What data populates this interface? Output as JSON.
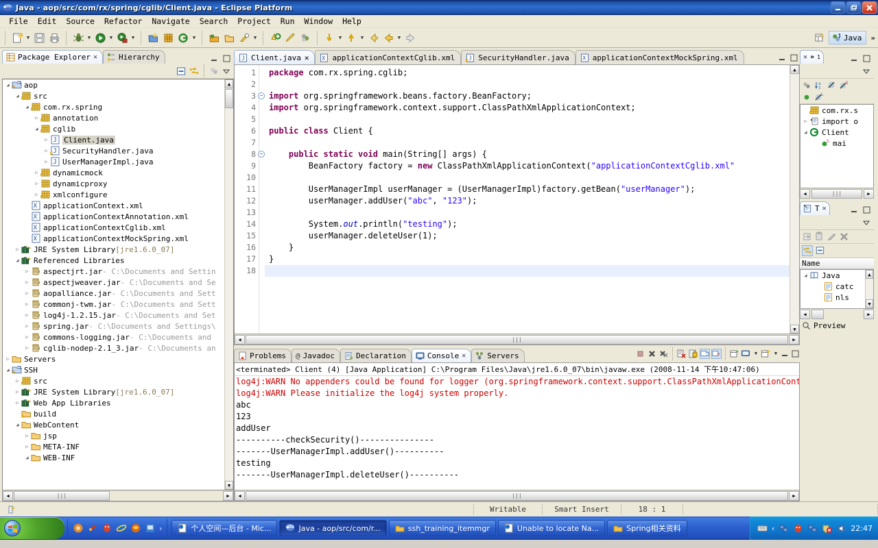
{
  "window": {
    "title": "Java - aop/src/com/rx/spring/cglib/Client.java - Eclipse Platform",
    "minimize": "—",
    "restore": "❐",
    "close": "✕"
  },
  "menubar": {
    "items": [
      "File",
      "Edit",
      "Source",
      "Refactor",
      "Navigate",
      "Search",
      "Project",
      "Run",
      "Window",
      "Help"
    ]
  },
  "toolbar": {
    "perspective_label": "Java",
    "overflow": "»"
  },
  "package_explorer": {
    "tabs": [
      {
        "label": "Package Explorer",
        "icon": "package-explorer-icon",
        "active": true
      },
      {
        "label": "Hierarchy",
        "icon": "hierarchy-icon",
        "active": false
      }
    ],
    "tree": [
      {
        "indent": 0,
        "arrow": "down",
        "icon": "project",
        "label": "aop"
      },
      {
        "indent": 1,
        "arrow": "down",
        "icon": "srcfolder",
        "label": "src"
      },
      {
        "indent": 2,
        "arrow": "down",
        "icon": "package",
        "label": "com.rx.spring"
      },
      {
        "indent": 3,
        "arrow": "right",
        "icon": "package",
        "label": "annotation"
      },
      {
        "indent": 3,
        "arrow": "down",
        "icon": "package",
        "label": "cglib"
      },
      {
        "indent": 4,
        "arrow": "right",
        "icon": "java",
        "label": "Client.java",
        "selected": true
      },
      {
        "indent": 4,
        "arrow": "right",
        "icon": "javawarn",
        "label": "SecurityHandler.java"
      },
      {
        "indent": 4,
        "arrow": "right",
        "icon": "java",
        "label": "UserManagerImpl.java"
      },
      {
        "indent": 3,
        "arrow": "right",
        "icon": "package",
        "label": "dynamicmock"
      },
      {
        "indent": 3,
        "arrow": "right",
        "icon": "packageplain",
        "label": "dynamicproxy"
      },
      {
        "indent": 3,
        "arrow": "right",
        "icon": "package",
        "label": "xmlconfigure"
      },
      {
        "indent": 2,
        "arrow": "none",
        "icon": "xml",
        "label": "applicationContext.xml"
      },
      {
        "indent": 2,
        "arrow": "none",
        "icon": "xml",
        "label": "applicationContextAnnotation.xml"
      },
      {
        "indent": 2,
        "arrow": "none",
        "icon": "xml",
        "label": "applicationContextCglib.xml"
      },
      {
        "indent": 2,
        "arrow": "none",
        "icon": "xml",
        "label": "applicationContextMockSpring.xml"
      },
      {
        "indent": 1,
        "arrow": "right",
        "icon": "library",
        "label": "JRE System Library ",
        "dim": "[jre1.6.0_07]"
      },
      {
        "indent": 1,
        "arrow": "down",
        "icon": "library",
        "label": "Referenced Libraries"
      },
      {
        "indent": 2,
        "arrow": "right",
        "icon": "jar",
        "label": "aspectjrt.jar",
        "gray": " - C:\\Documents and Settin"
      },
      {
        "indent": 2,
        "arrow": "right",
        "icon": "jar",
        "label": "aspectjweaver.jar",
        "gray": " - C:\\Documents and Se"
      },
      {
        "indent": 2,
        "arrow": "right",
        "icon": "jar",
        "label": "aopalliance.jar",
        "gray": " - C:\\Documents and Sett"
      },
      {
        "indent": 2,
        "arrow": "right",
        "icon": "jar",
        "label": "commonj-twm.jar",
        "gray": " - C:\\Documents and Sett"
      },
      {
        "indent": 2,
        "arrow": "right",
        "icon": "jar",
        "label": "log4j-1.2.15.jar",
        "gray": " - C:\\Documents and Set"
      },
      {
        "indent": 2,
        "arrow": "right",
        "icon": "jar",
        "label": "spring.jar",
        "gray": " - C:\\Documents and Settings\\"
      },
      {
        "indent": 2,
        "arrow": "right",
        "icon": "jar",
        "label": "commons-logging.jar",
        "gray": " - C:\\Documents and "
      },
      {
        "indent": 2,
        "arrow": "right",
        "icon": "jar",
        "label": "cglib-nodep-2.1_3.jar",
        "gray": " - C:\\Documents an"
      },
      {
        "indent": 0,
        "arrow": "right",
        "icon": "folder",
        "label": "Servers"
      },
      {
        "indent": 0,
        "arrow": "down",
        "icon": "project",
        "label": "SSH"
      },
      {
        "indent": 1,
        "arrow": "right",
        "icon": "srcfolder",
        "label": "src"
      },
      {
        "indent": 1,
        "arrow": "right",
        "icon": "library",
        "label": "JRE System Library ",
        "dim": "[jre1.6.0_07]"
      },
      {
        "indent": 1,
        "arrow": "right",
        "icon": "library",
        "label": "Web App Libraries"
      },
      {
        "indent": 1,
        "arrow": "none",
        "icon": "folderwarn",
        "label": "build"
      },
      {
        "indent": 1,
        "arrow": "down",
        "icon": "folder",
        "label": "WebContent"
      },
      {
        "indent": 2,
        "arrow": "right",
        "icon": "folder",
        "label": "jsp"
      },
      {
        "indent": 2,
        "arrow": "right",
        "icon": "folder",
        "label": "META-INF"
      },
      {
        "indent": 2,
        "arrow": "down",
        "icon": "folder",
        "label": "WEB-INF"
      }
    ]
  },
  "editor": {
    "tabs": [
      {
        "label": "Client.java",
        "icon": "java-file-icon",
        "active": true,
        "closable": true
      },
      {
        "label": "applicationContextCglib.xml",
        "icon": "xml-file-icon",
        "active": false
      },
      {
        "label": "SecurityHandler.java",
        "icon": "java-warn-file-icon",
        "active": false
      },
      {
        "label": "applicationContextMockSpring.xml",
        "icon": "xml-file-icon",
        "active": false
      }
    ],
    "lines": [
      {
        "n": 1,
        "fold": false,
        "html": "<span class=\"kw\">package</span> com.rx.spring.cglib;"
      },
      {
        "n": 2,
        "fold": false,
        "html": ""
      },
      {
        "n": 3,
        "fold": true,
        "html": "<span class=\"kw\">import</span> org.springframework.beans.factory.BeanFactory;"
      },
      {
        "n": 4,
        "fold": false,
        "html": "<span class=\"kw\">import</span> org.springframework.context.support.ClassPathXmlApplicationContext;"
      },
      {
        "n": 5,
        "fold": false,
        "html": ""
      },
      {
        "n": 6,
        "fold": false,
        "html": "<span class=\"kw\">public class</span> Client {"
      },
      {
        "n": 7,
        "fold": false,
        "html": ""
      },
      {
        "n": 8,
        "fold": true,
        "html": "    <span class=\"kw\">public static void</span> main(String[] args) {"
      },
      {
        "n": 9,
        "fold": false,
        "html": "        BeanFactory factory = <span class=\"kw\">new</span> ClassPathXmlApplicationContext(<span class=\"str\">\"applicationContextCglib.xml\"</span>"
      },
      {
        "n": 10,
        "fold": false,
        "html": ""
      },
      {
        "n": 11,
        "fold": false,
        "html": "        UserManagerImpl userManager = (UserManagerImpl)factory.getBean(<span class=\"str\">\"userManager\"</span>);"
      },
      {
        "n": 12,
        "fold": false,
        "html": "        userManager.addUser(<span class=\"str\">\"abc\"</span>, <span class=\"str\">\"123\"</span>);"
      },
      {
        "n": 13,
        "fold": false,
        "html": ""
      },
      {
        "n": 14,
        "fold": false,
        "html": "        System.<span class=\"fld\">out</span>.println(<span class=\"str\">\"testing\"</span>);"
      },
      {
        "n": 15,
        "fold": false,
        "html": "        userManager.deleteUser(1);"
      },
      {
        "n": 16,
        "fold": false,
        "html": "    }"
      },
      {
        "n": 17,
        "fold": false,
        "html": "}"
      },
      {
        "n": 18,
        "fold": false,
        "html": "",
        "current": true
      }
    ]
  },
  "console": {
    "tabs": [
      {
        "label": "Problems",
        "icon": "problems-icon",
        "active": false
      },
      {
        "label": "Javadoc",
        "icon": "javadoc-icon",
        "active": false
      },
      {
        "label": "Declaration",
        "icon": "declaration-icon",
        "active": false
      },
      {
        "label": "Console",
        "icon": "console-icon",
        "active": true,
        "closable": true
      },
      {
        "label": "Servers",
        "icon": "servers-icon",
        "active": false
      }
    ],
    "launch_header": "<terminated> Client (4) [Java Application] C:\\Program Files\\Java\\jre1.6.0_07\\bin\\javaw.exe (2008-11-14 下午10:47:06)",
    "lines": [
      {
        "text": "log4j:WARN No appenders could be found for logger (org.springframework.context.support.ClassPathXmlApplicationCont",
        "error": true
      },
      {
        "text": "log4j:WARN Please initialize the log4j system properly.",
        "error": true
      },
      {
        "text": "abc",
        "error": false
      },
      {
        "text": "123",
        "error": false
      },
      {
        "text": "addUser",
        "error": false
      },
      {
        "text": "----------checkSecurity()---------------",
        "error": false
      },
      {
        "text": "-------UserManagerImpl.addUser()----------",
        "error": false
      },
      {
        "text": "testing",
        "error": false
      },
      {
        "text": "-------UserManagerImpl.deleteUser()----------",
        "error": false
      }
    ]
  },
  "outline": {
    "tab_overflow": "»",
    "tab_count": "1",
    "items": [
      {
        "indent": 0,
        "arrow": "none",
        "icon": "package",
        "label": "com.rx.s"
      },
      {
        "indent": 0,
        "arrow": "right",
        "icon": "imports",
        "label": "import o"
      },
      {
        "indent": 0,
        "arrow": "down",
        "icon": "class",
        "label": "Client"
      },
      {
        "indent": 1,
        "arrow": "none",
        "icon": "method",
        "label": "mai"
      }
    ]
  },
  "tasks": {
    "tab_label": "T",
    "column_name": "Name",
    "items": [
      {
        "indent": 0,
        "arrow": "down",
        "icon": "book",
        "label": "Java"
      },
      {
        "indent": 1,
        "arrow": "none",
        "icon": "template",
        "label": "catc"
      },
      {
        "indent": 1,
        "arrow": "none",
        "icon": "template",
        "label": "nls"
      }
    ],
    "preview_label": "Preview"
  },
  "statusbar": {
    "writable": "Writable",
    "insert_mode": "Smart Insert",
    "position": "18 : 1"
  },
  "taskbar": {
    "start_label": "",
    "buttons": [
      {
        "label": "个人空间—后台 - Mic...",
        "icon": "ie-doc-icon",
        "active": false
      },
      {
        "label": "Java - aop/src/com/r...",
        "icon": "eclipse-icon",
        "active": true
      },
      {
        "label": "ssh_training_itemmgr",
        "icon": "folder-icon",
        "active": false
      },
      {
        "label": "Unable to locate Na...",
        "icon": "ie-doc-icon",
        "active": false
      },
      {
        "label": "Spring相关资料",
        "icon": "folder-icon",
        "active": false
      }
    ],
    "clock": "22:47"
  }
}
